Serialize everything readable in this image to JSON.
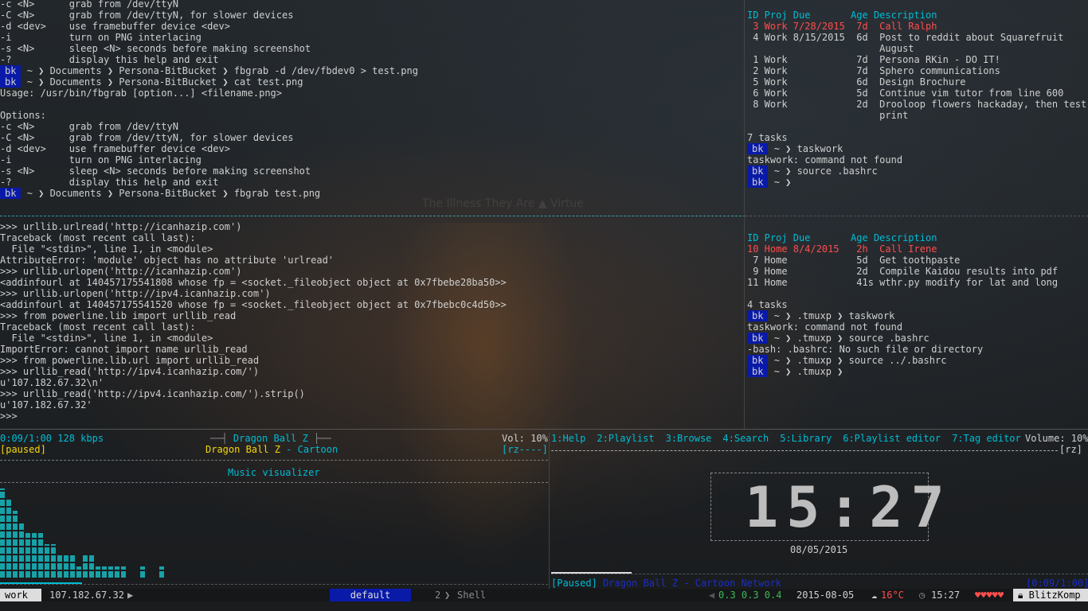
{
  "colors": {
    "accent": "#00bcd4",
    "red": "#ff4d4d",
    "yellow": "#f5d60c",
    "prompt_bg": "#0a1aa8"
  },
  "top_left": {
    "lines": [
      "-c <N>      grab from /dev/ttyN",
      "-C <N>      grab from /dev/ttyN, for slower devices",
      "-d <dev>    use framebuffer device <dev>",
      "-i          turn on PNG interlacing",
      "-s <N>      sleep <N> seconds before making screenshot",
      "-?          display this help and exit"
    ],
    "prompt1": "~ ❯ Documents ❯ Persona-BitBucket ❯ fbgrab -d /dev/fbdev0 > test.png",
    "prompt2": "~ ❯ Documents ❯ Persona-BitBucket ❯ cat test.png",
    "usage": "Usage: /usr/bin/fbgrab [option...] <filename.png>",
    "options_title": "Options:",
    "lines2": [
      "-c <N>      grab from /dev/ttyN",
      "-C <N>      grab from /dev/ttyN, for slower devices",
      "-d <dev>    use framebuffer device <dev>",
      "-i          turn on PNG interlacing",
      "-s <N>      sleep <N> seconds before making screenshot",
      "-?          display this help and exit"
    ],
    "prompt3": "~ ❯ Documents ❯ Persona-BitBucket ❯ fbgrab test.png",
    "cursor": "_",
    "bk": "bk"
  },
  "top_right": {
    "header": "ID Proj Due       Age Description",
    "row_red": " 3 Work 7/28/2015  7d  Call Ralph",
    "rows": [
      " 4 Work 8/15/2015  6d  Post to reddit about Squarefruit",
      "                       August",
      " 1 Work            7d  Persona RKin - DO IT!",
      " 2 Work            7d  Sphero communications",
      " 5 Work            6d  Design Brochure",
      " 6 Work            5d  Continue vim tutor from line 600",
      " 8 Work            2d  Drooloop flowers hackaday, then test",
      "                       print"
    ],
    "count": "7 tasks",
    "p1": "~ ❯ taskwork",
    "err": "taskwork: command not found",
    "p2": "~ ❯ source .bashrc",
    "p3": "~ ❯"
  },
  "mid_right": {
    "header": "ID Proj Due       Age Description",
    "row_red": "10 Home 8/4/2015   2h  Call Irene",
    "rows": [
      " 7 Home            5d  Get toothpaste",
      " 9 Home            2d  Compile Kaidou results into pdf",
      "11 Home            41s wthr.py modify for lat and long"
    ],
    "count": "4 tasks",
    "p1": "~ ❯ .tmuxp ❯ taskwork",
    "err": "taskwork: command not found",
    "p2": "~ ❯ .tmuxp ❯ source .bashrc",
    "err2": "-bash: .bashrc: No such file or directory",
    "p3": "~ ❯ .tmuxp ❯ source ../.bashrc",
    "p4": "~ ❯ .tmuxp ❯"
  },
  "python": {
    "lines": [
      ">>> urllib.urlread('http://icanhazip.com')",
      "Traceback (most recent call last):",
      "  File \"<stdin>\", line 1, in <module>",
      "AttributeError: 'module' object has no attribute 'urlread'",
      ">>> urllib.urlopen('http://icanhazip.com')",
      "<addinfourl at 140457175541808 whose fp = <socket._fileobject object at 0x7fbebe28ba50>>",
      ">>> urllib.urlopen('http://ipv4.icanhazip.com')",
      "<addinfourl at 140457175541520 whose fp = <socket._fileobject object at 0x7fbebc0c4d50>>",
      ">>> from powerline.lib import urllib_read",
      "Traceback (most recent call last):",
      "  File \"<stdin>\", line 1, in <module>",
      "ImportError: cannot import name urllib_read",
      ">>> from powerline.lib.url import urllib_read",
      ">>> urllib_read('http://ipv4.icanhazip.com/')",
      "u'107.182.67.32\\n'",
      ">>> urllib_read('http://ipv4.icanhazip.com/').strip()",
      "u'107.182.67.32'",
      ">>>"
    ],
    "watermark": "The Illness They Are ▲ Virtue"
  },
  "ncmpcpp_left": {
    "time": "0:09/1:00 128 kbps",
    "paused": "[paused]",
    "title": "Dragon Ball Z",
    "subtitle_song": "Dragon Ball Z",
    "subtitle_rest": " - Cartoon",
    "volume": "Vol: 10%",
    "flags": "[rz----]",
    "visualizer": "Music visualizer",
    "bars": [
      8,
      7,
      6,
      5,
      4,
      4,
      4,
      3,
      3,
      2,
      2,
      2,
      1,
      2,
      2,
      1,
      1,
      1,
      1,
      1,
      0,
      0,
      1,
      0,
      0,
      1
    ],
    "progress": 0.15
  },
  "ncmpcpp_right": {
    "menu": [
      "1:Help",
      "2:Playlist",
      "3:Browse",
      "4:Search",
      "5:Library",
      "6:Playlist editor",
      "7:Tag editor"
    ],
    "volume": "Volume: 10%",
    "flags": "[rz]",
    "clock_time": "15:27",
    "clock_date": "08/05/2015",
    "paused": "[Paused]",
    "song": "Dragon Ball Z",
    "song_rest": " - Cartoon Network",
    "elapsed": "[0:09/1:00]",
    "progress": 0.15
  },
  "statusbar": {
    "session": "work",
    "ip": "107.182.67.32",
    "window": "default",
    "win2_num": "2",
    "win2_name": "Shell",
    "load": "0.3 0.3 0.4",
    "date": "2015-08-05",
    "temp": "16°C",
    "time": "15:27",
    "hearts": "♥♥♥♥♥",
    "host": "BlitzKomp"
  }
}
